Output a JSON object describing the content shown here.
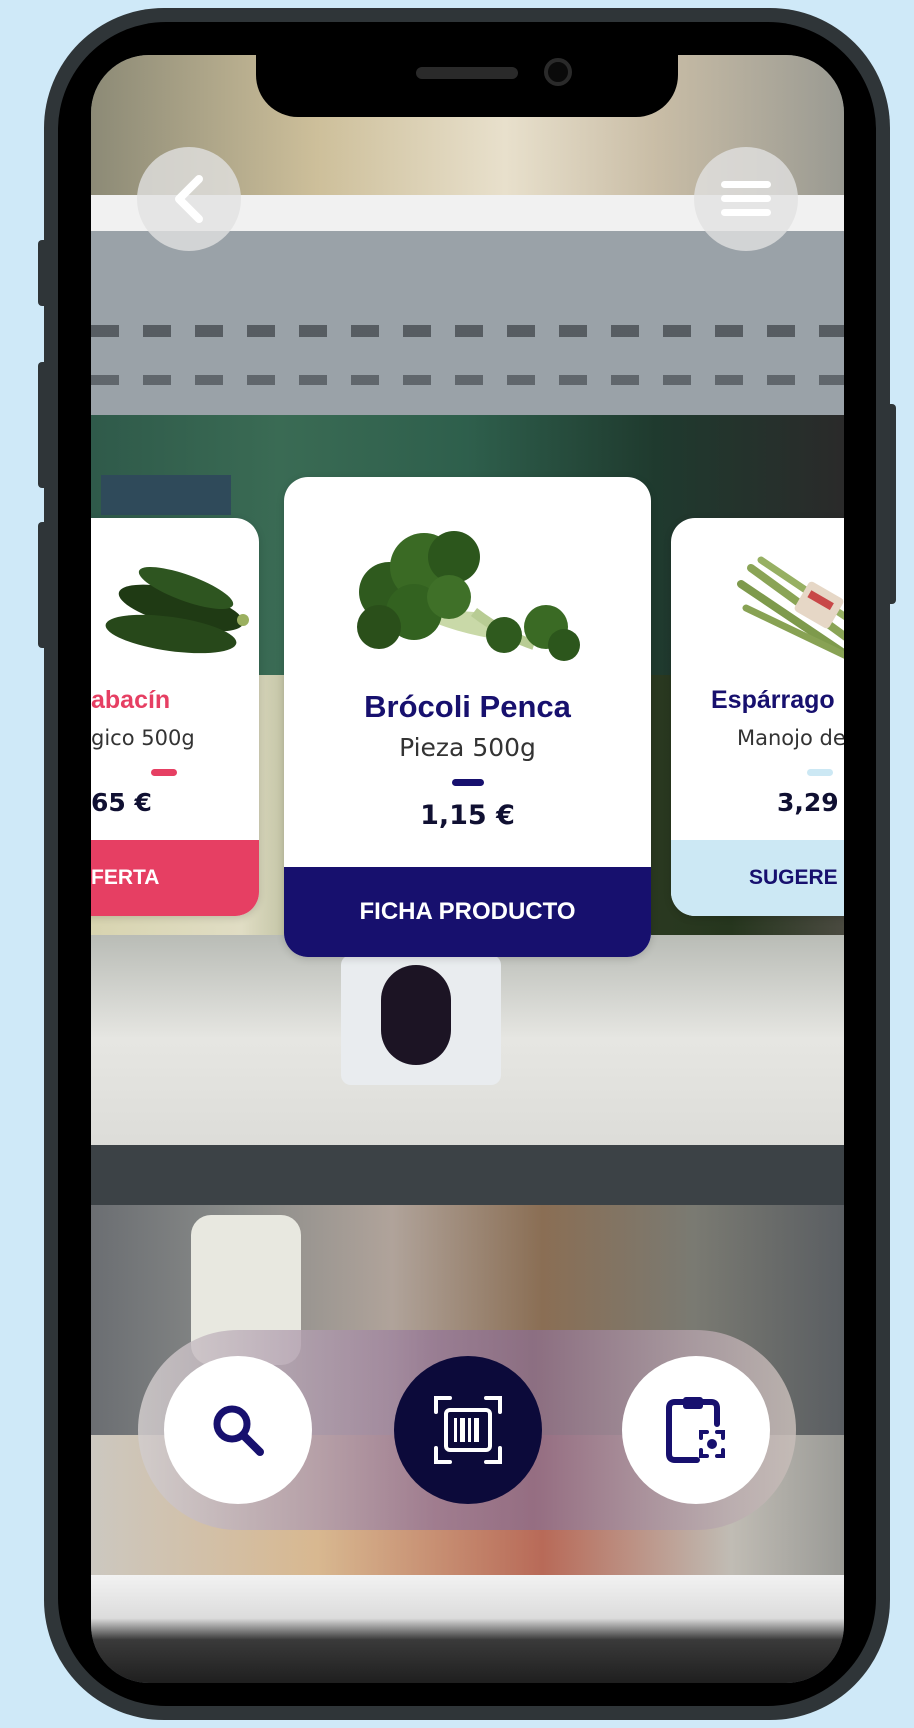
{
  "colors": {
    "navy": "#17106e",
    "accent_pink": "#e63f63",
    "light_blue": "#cce8f4",
    "dark_button": "#0c0a3a"
  },
  "top_bar": {
    "back_icon": "chevron-left-icon",
    "menu_icon": "hamburger-menu-icon"
  },
  "products": [
    {
      "name": "abacín",
      "description": "gico 500g",
      "price": "65 €",
      "button_label": "FERTA",
      "accent": "#e63f63",
      "image_icon": "zucchini-image"
    },
    {
      "name": "Brócoli Penca",
      "description": "Pieza 500g",
      "price": "1,15 €",
      "button_label": "FICHA PRODUCTO",
      "accent": "#17106e",
      "image_icon": "broccoli-image"
    },
    {
      "name": "Espárrago",
      "description": "Manojo de",
      "price": "3,29",
      "button_label": "SUGERE",
      "accent": "#cce8f4",
      "image_icon": "asparagus-image"
    }
  ],
  "bottom_bar": {
    "search_icon": "search-icon",
    "scan_icon": "barcode-scan-icon",
    "clipboard_icon": "clipboard-scan-icon"
  }
}
